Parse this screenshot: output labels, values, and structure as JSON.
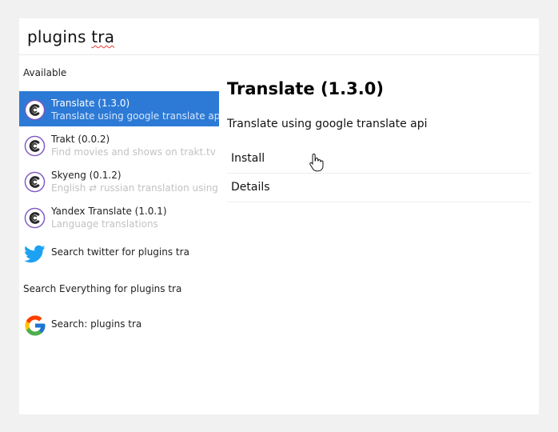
{
  "search": {
    "query_prefix": "plugins ",
    "query_misspelled": "tra"
  },
  "sections": {
    "available": "Available",
    "everything": "Search Everything for plugins tra"
  },
  "results": [
    {
      "title": "Translate (1.3.0)",
      "subtitle": "Translate using google translate api",
      "icon": "cerebro-plugin-icon"
    },
    {
      "title": "Trakt (0.0.2)",
      "subtitle": "Find movies and shows on trakt.tv",
      "icon": "cerebro-plugin-icon"
    },
    {
      "title": "Skyeng (0.1.2)",
      "subtitle": "English ⇄ russian translation using api of",
      "icon": "cerebro-plugin-icon"
    },
    {
      "title": "Yandex Translate (1.0.1)",
      "subtitle": "Language translations",
      "icon": "cerebro-plugin-icon"
    },
    {
      "title": "Search twitter for plugins tra",
      "icon": "twitter-icon"
    }
  ],
  "everything_results": [
    {
      "title": "Search: plugins tra",
      "icon": "google-icon"
    }
  ],
  "detail": {
    "title": "Translate (1.3.0)",
    "description": "Translate using google translate api",
    "actions": [
      "Install",
      "Details"
    ]
  },
  "colors": {
    "selection": "#2c7ad6",
    "background": "#f1f1f1",
    "twitter": "#1da1f2",
    "plugin_icon": "#7e57c2"
  }
}
